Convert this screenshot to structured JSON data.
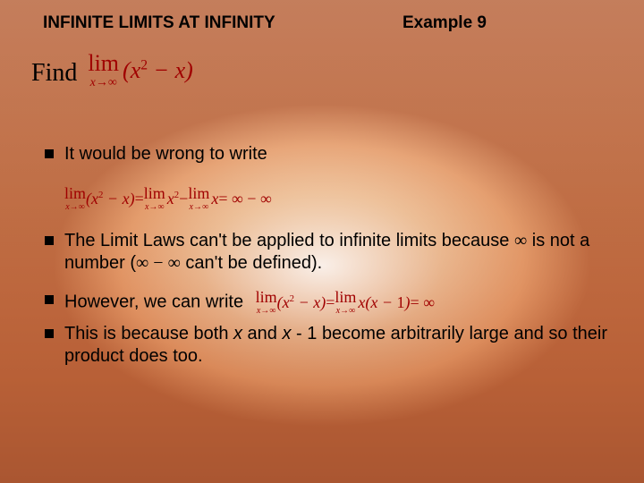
{
  "header": {
    "title": "INFINITE LIMITS AT INFINITY",
    "example": "Example 9"
  },
  "find_label": "Find",
  "main_expr": {
    "lim": "lim",
    "sub": "x→∞",
    "body": "(x² − x)"
  },
  "bullets": [
    {
      "text": "It would be wrong to write"
    },
    {
      "text_pre": "The Limit Laws can't be applied to infinite limits because ",
      "inf1": "∞",
      "text_mid": " is not a number (",
      "inf_expr": "∞ − ∞",
      "text_post": " can't be defined)."
    },
    {
      "text": "However, we can write"
    },
    {
      "text_pre": "This is because both ",
      "x1": "x",
      "text_mid": " and ",
      "x2": "x",
      "minus1": " - 1 become arbitrarily large and so their product does too."
    }
  ],
  "wrong_math": {
    "lhs_lim": "lim",
    "lhs_sub": "x→∞",
    "lhs_body": "(x² − x)",
    "eq1": " = ",
    "t1_lim": "lim",
    "t1_sub": "x→∞",
    "t1_body": "x²",
    "minus": " − ",
    "t2_lim": "lim",
    "t2_sub": "x→∞",
    "t2_body": "x",
    "eq2": " = ∞ − ∞"
  },
  "right_math": {
    "lhs_lim": "lim",
    "lhs_sub": "x→∞",
    "lhs_body": "(x² − x)",
    "eq1": " = ",
    "t1_lim": "lim",
    "t1_sub": "x→∞",
    "t1_body": "x(x − 1)",
    "eq2": " = ∞"
  }
}
